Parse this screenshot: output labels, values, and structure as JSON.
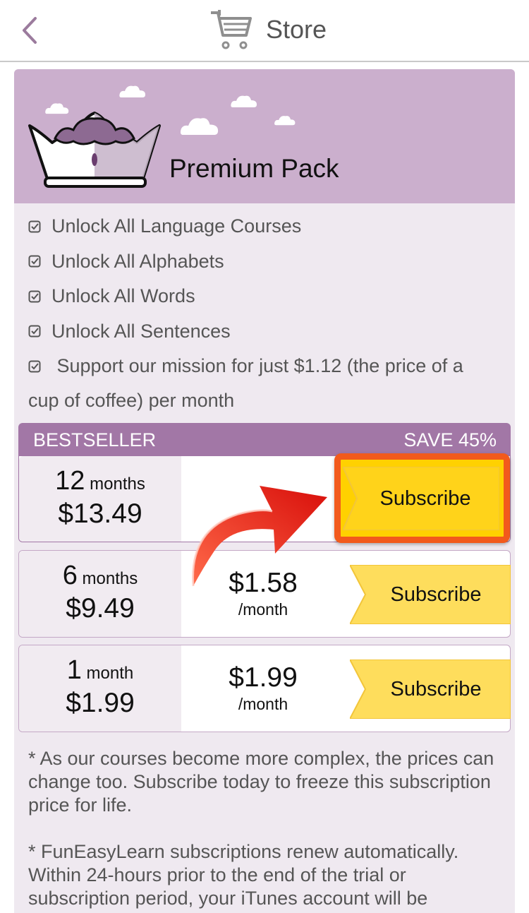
{
  "header": {
    "title": "Store",
    "back_icon": "chevron-left-icon",
    "cart_icon": "shopping-cart-icon"
  },
  "pack": {
    "title": "Premium Pack",
    "features": [
      "Unlock All Language Courses",
      "Unlock All Alphabets",
      "Unlock All Words",
      "Unlock All Sentences"
    ],
    "mission_line1": "Support our mission for just $1.12 (the price of a",
    "mission_line2": "cup of coffee) per month"
  },
  "bestseller": {
    "label": "BESTSELLER",
    "save": "SAVE 45%"
  },
  "plans": [
    {
      "num": "12",
      "unit": "months",
      "price": "$13.49",
      "monthly": "",
      "per": "",
      "button": "Subscribe",
      "highlighted": true
    },
    {
      "num": "6",
      "unit": "months",
      "price": "$9.49",
      "monthly": "$1.58",
      "per": "/month",
      "button": "Subscribe",
      "highlighted": false
    },
    {
      "num": "1",
      "unit": "month",
      "price": "$1.99",
      "monthly": "$1.99",
      "per": "/month",
      "button": "Subscribe",
      "highlighted": false
    }
  ],
  "notes": {
    "note1": "* As our courses become more complex, the prices can change too. Subscribe today to freeze this subscription price for life.",
    "note2": "* FunEasyLearn subscriptions renew automatically. Within 24-hours prior to the end of the trial or subscription period, your iTunes account will be"
  },
  "colors": {
    "banner": "#cbafcd",
    "card_bg": "#efe9f0",
    "bestseller_bar": "#a277a6",
    "button_yellow": "#fedd5c",
    "highlight_orange": "#f25a1c",
    "arrow_red": "#e3140e"
  }
}
